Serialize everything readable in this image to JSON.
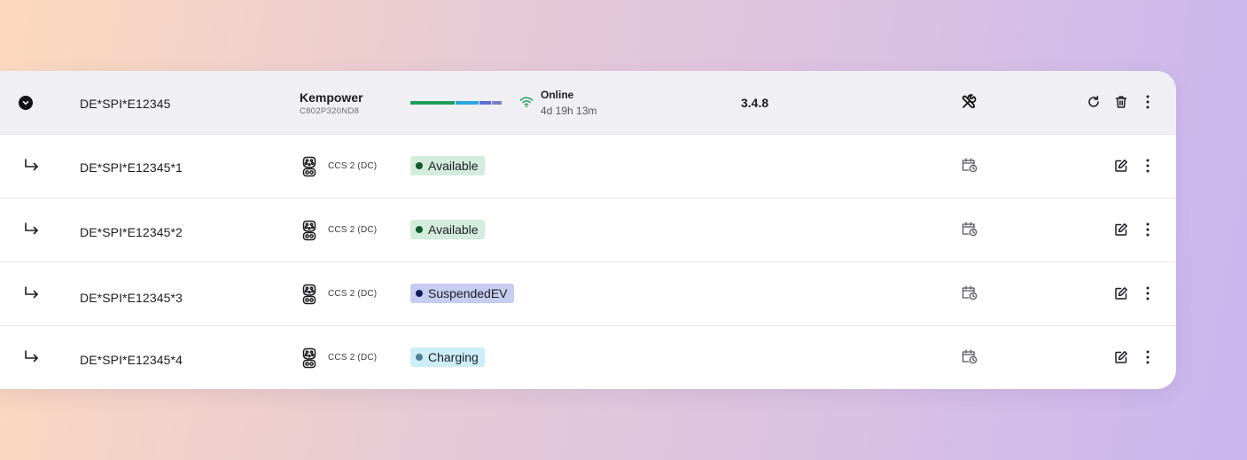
{
  "station": {
    "id": "DE*SPI*E12345",
    "vendor": "Kempower",
    "serial": "C802P320ND8",
    "status": "Online",
    "uptime": "4d 19h 13m",
    "firmware": "3.4.8",
    "status_bar_colors": [
      "#1f9d55",
      "#2aa7df",
      "#5b6fd6",
      "#7b7fd0"
    ],
    "status_bar_fractions": [
      0.5,
      0.26,
      0.13,
      0.11
    ]
  },
  "connectors": [
    {
      "id": "DE*SPI*E12345*1",
      "type": "CCS 2 (DC)",
      "status": "Available",
      "badge_bg": "#d4ecdc",
      "dot": "#0f5a2c"
    },
    {
      "id": "DE*SPI*E12345*2",
      "type": "CCS 2 (DC)",
      "status": "Available",
      "badge_bg": "#d4ecdc",
      "dot": "#0f5a2c"
    },
    {
      "id": "DE*SPI*E12345*3",
      "type": "CCS 2 (DC)",
      "status": "SuspendedEV",
      "badge_bg": "#c7cdf0",
      "dot": "#141d5a"
    },
    {
      "id": "DE*SPI*E12345*4",
      "type": "CCS 2 (DC)",
      "status": "Charging",
      "badge_bg": "#cdeef7",
      "dot": "#4f7f93"
    }
  ],
  "icons": {
    "expand": "chevron-down-icon",
    "maintenance": "wrench-screwdriver-icon",
    "refresh": "refresh-icon",
    "delete": "trash-icon",
    "more": "kebab-icon",
    "child": "corner-down-right-icon",
    "plug": "ccs2-plug-icon",
    "schedule": "calendar-clock-icon",
    "edit": "edit-icon",
    "signal": "wifi-icon"
  }
}
